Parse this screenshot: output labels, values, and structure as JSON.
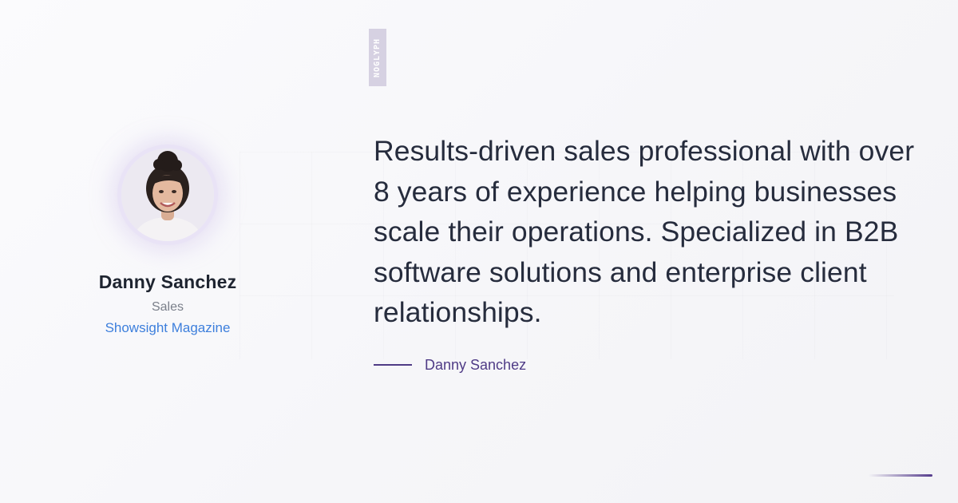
{
  "brand": {
    "logo_text": "NOGLYPH"
  },
  "profile": {
    "name": "Danny Sanchez",
    "role": "Sales",
    "company": "Showsight Magazine"
  },
  "quote": {
    "text": "Results-driven sales professional with over 8 years of experience helping businesses scale their operations. Specialized in B2B software solutions and enterprise client relationships."
  },
  "attribution": {
    "name": "Danny Sanchez"
  },
  "colors": {
    "accent": "#4f3b86",
    "company_link": "#3d7fdc",
    "quote_text": "#262c3d"
  }
}
